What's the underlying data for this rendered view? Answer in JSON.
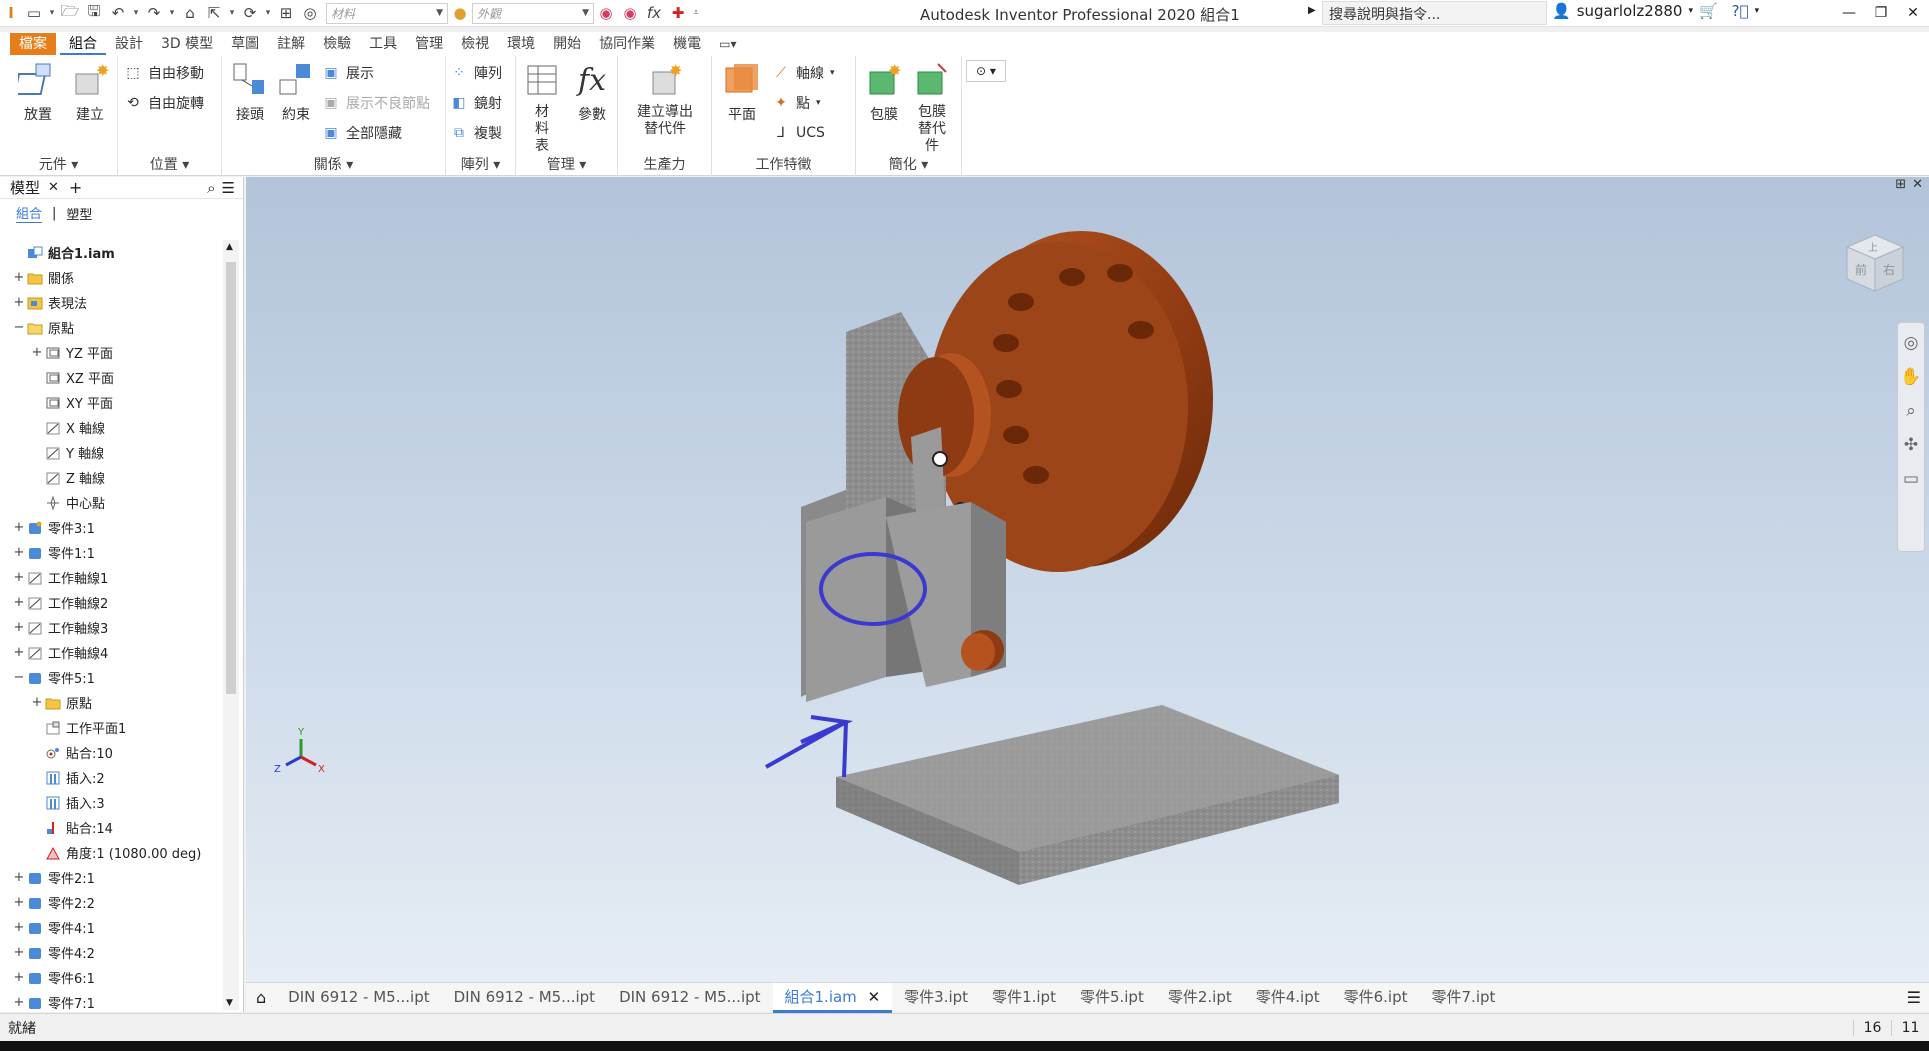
{
  "titlebar": {
    "app_title": "Autodesk Inventor Professional 2020    組合1",
    "material_placeholder": "材料",
    "appearance_placeholder": "外觀",
    "search_placeholder": "搜尋說明與指令...",
    "username": "sugarlolz2880"
  },
  "ribbon_tabs": [
    "檔案",
    "組合",
    "設計",
    "3D 模型",
    "草圖",
    "註解",
    "檢驗",
    "工具",
    "管理",
    "檢視",
    "環境",
    "開始",
    "協同作業",
    "機電"
  ],
  "ribbon": {
    "component": {
      "label": "元件",
      "place": "放置",
      "create": "建立"
    },
    "position": {
      "label": "位置",
      "free_move": "自由移動",
      "free_rotate": "自由旋轉"
    },
    "relationships": {
      "label": "關係",
      "joint": "接頭",
      "constrain": "約束",
      "show": "展示",
      "show_sick": "展示不良節點",
      "hide_all": "全部隱藏"
    },
    "pattern": {
      "label": "陣列",
      "pattern": "陣列",
      "mirror": "鏡射",
      "copy": "複製"
    },
    "manage": {
      "label": "管理",
      "bom": "材料表",
      "params": "參數"
    },
    "productivity": {
      "label": "生產力",
      "derived_sub": "建立導出替代件"
    },
    "work_features": {
      "label": "工作特徵",
      "plane": "平面",
      "axis": "軸線",
      "point": "點",
      "ucs": "UCS"
    },
    "simplification": {
      "label": "簡化",
      "shrinkwrap": "包膜",
      "shrinkwrap_sub": "包膜替代件"
    }
  },
  "browser": {
    "title": "模型",
    "tab_assembly": "組合",
    "tab_modeling": "塑型",
    "tree": [
      {
        "label": "組合1.iam",
        "indent": 0,
        "exp": "",
        "icon": "assembly",
        "bold": true
      },
      {
        "label": "關係",
        "indent": 0,
        "exp": "+",
        "icon": "folder"
      },
      {
        "label": "表現法",
        "indent": 0,
        "exp": "+",
        "icon": "representation"
      },
      {
        "label": "原點",
        "indent": 0,
        "exp": "−",
        "icon": "folder-open"
      },
      {
        "label": "YZ 平面",
        "indent": 1,
        "exp": "+",
        "icon": "plane"
      },
      {
        "label": "XZ 平面",
        "indent": 1,
        "exp": "",
        "icon": "plane"
      },
      {
        "label": "XY 平面",
        "indent": 1,
        "exp": "",
        "icon": "plane"
      },
      {
        "label": "X 軸線",
        "indent": 1,
        "exp": "",
        "icon": "axis"
      },
      {
        "label": "Y 軸線",
        "indent": 1,
        "exp": "",
        "icon": "axis"
      },
      {
        "label": "Z 軸線",
        "indent": 1,
        "exp": "",
        "icon": "axis"
      },
      {
        "label": "中心點",
        "indent": 1,
        "exp": "",
        "icon": "point"
      },
      {
        "label": "零件3:1",
        "indent": 0,
        "exp": "+",
        "icon": "part-grounded"
      },
      {
        "label": "零件1:1",
        "indent": 0,
        "exp": "+",
        "icon": "part"
      },
      {
        "label": "工作軸線1",
        "indent": 0,
        "exp": "+",
        "icon": "axis"
      },
      {
        "label": "工作軸線2",
        "indent": 0,
        "exp": "+",
        "icon": "axis"
      },
      {
        "label": "工作軸線3",
        "indent": 0,
        "exp": "+",
        "icon": "axis"
      },
      {
        "label": "工作軸線4",
        "indent": 0,
        "exp": "+",
        "icon": "axis"
      },
      {
        "label": "零件5:1",
        "indent": 0,
        "exp": "−",
        "icon": "part"
      },
      {
        "label": "原點",
        "indent": 1,
        "exp": "+",
        "icon": "folder"
      },
      {
        "label": "工作平面1",
        "indent": 1,
        "exp": "",
        "icon": "workplane"
      },
      {
        "label": "貼合:10",
        "indent": 1,
        "exp": "",
        "icon": "mate"
      },
      {
        "label": "插入:2",
        "indent": 1,
        "exp": "",
        "icon": "insert"
      },
      {
        "label": "插入:3",
        "indent": 1,
        "exp": "",
        "icon": "insert"
      },
      {
        "label": "貼合:14",
        "indent": 1,
        "exp": "",
        "icon": "mate-flush"
      },
      {
        "label": "角度:1 (1080.00 deg)",
        "indent": 1,
        "exp": "",
        "icon": "angle"
      },
      {
        "label": "零件2:1",
        "indent": 0,
        "exp": "+",
        "icon": "part"
      },
      {
        "label": "零件2:2",
        "indent": 0,
        "exp": "+",
        "icon": "part"
      },
      {
        "label": "零件4:1",
        "indent": 0,
        "exp": "+",
        "icon": "part"
      },
      {
        "label": "零件4:2",
        "indent": 0,
        "exp": "+",
        "icon": "part"
      },
      {
        "label": "零件6:1",
        "indent": 0,
        "exp": "+",
        "icon": "part"
      },
      {
        "label": "零件7:1",
        "indent": 0,
        "exp": "+",
        "icon": "part"
      }
    ]
  },
  "doc_tabs": [
    {
      "label": "DIN 6912 - M5...ipt",
      "active": false
    },
    {
      "label": "DIN 6912 - M5...ipt",
      "active": false
    },
    {
      "label": "DIN 6912 - M5...ipt",
      "active": false
    },
    {
      "label": "組合1.iam",
      "active": true
    },
    {
      "label": "零件3.ipt",
      "active": false
    },
    {
      "label": "零件1.ipt",
      "active": false
    },
    {
      "label": "零件5.ipt",
      "active": false
    },
    {
      "label": "零件2.ipt",
      "active": false
    },
    {
      "label": "零件4.ipt",
      "active": false
    },
    {
      "label": "零件6.ipt",
      "active": false
    },
    {
      "label": "零件7.ipt",
      "active": false
    }
  ],
  "status": {
    "text": "就緒",
    "num1": "16",
    "num2": "11"
  },
  "viewcube": {
    "face_front": "前",
    "face_right": "右",
    "face_top": "上"
  },
  "colors": {
    "accent": "#3b7bd4",
    "file_tab": "#e57e18",
    "copper": "#a0461a",
    "steel": "#8a8a8a"
  }
}
